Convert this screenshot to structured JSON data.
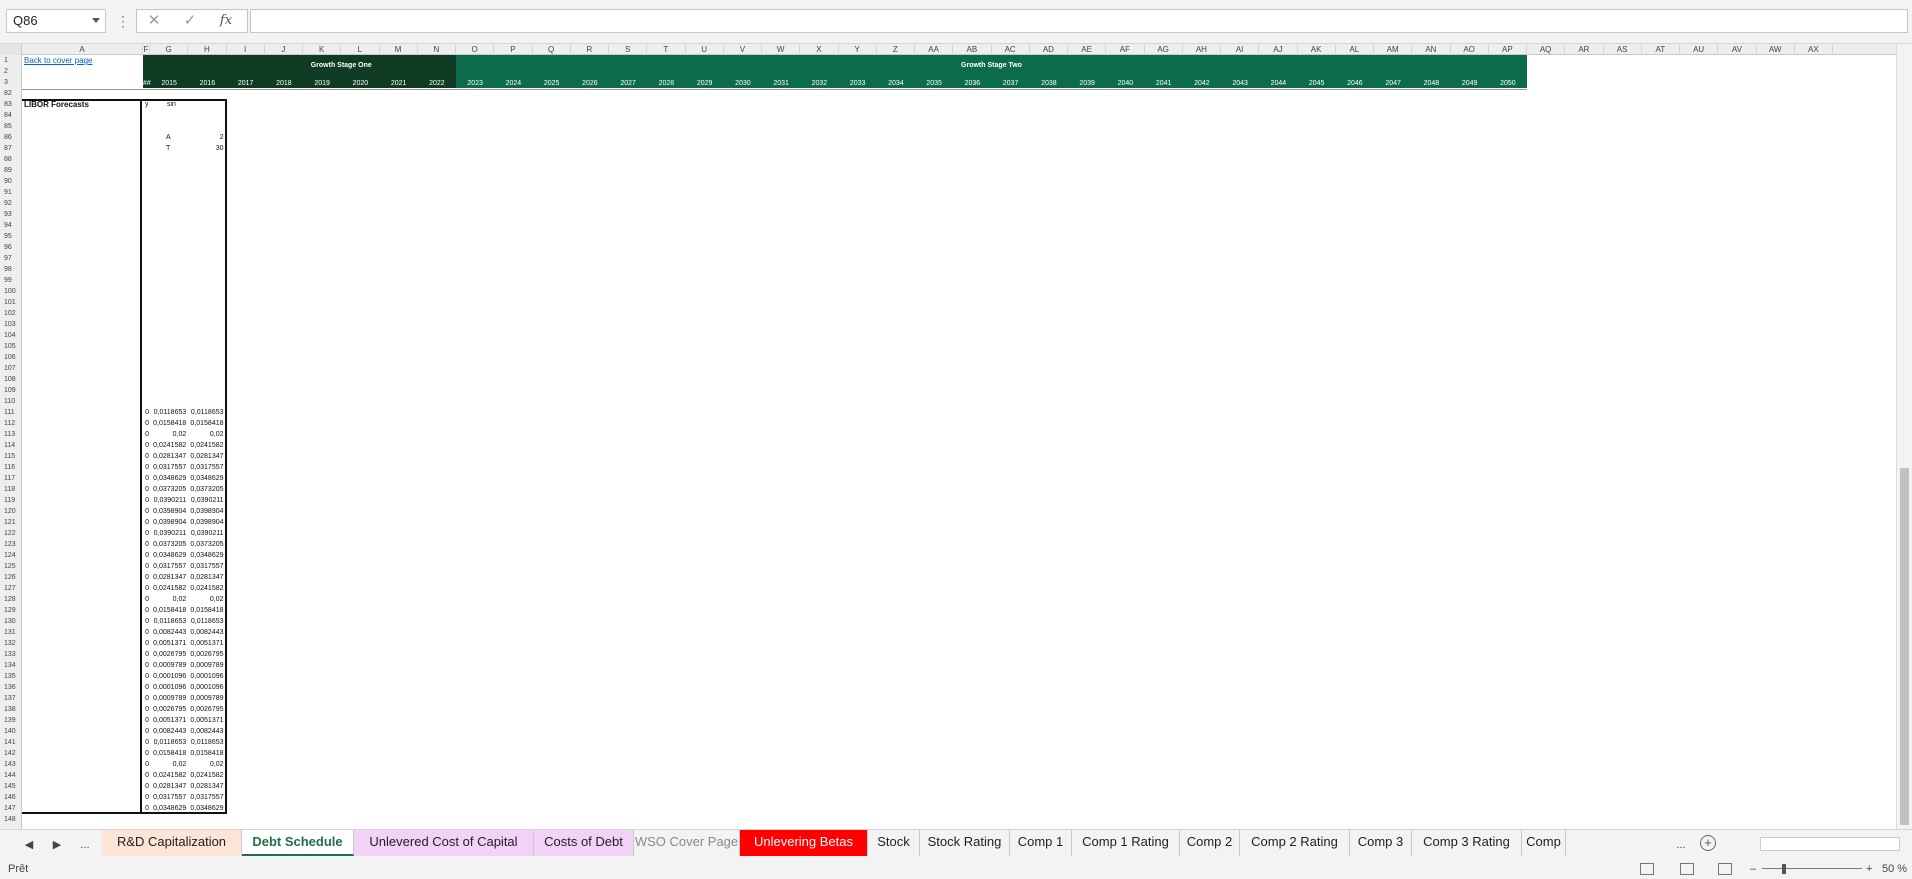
{
  "formula_bar": {
    "name_box": "Q86",
    "cancel_icon": "✕",
    "enter_icon": "✓",
    "fx_label": "fx",
    "formula": ""
  },
  "columns": [
    "A",
    "F",
    "G",
    "H",
    "I",
    "J",
    "K",
    "L",
    "M",
    "N",
    "O",
    "P",
    "Q",
    "R",
    "S",
    "T",
    "U",
    "V",
    "W",
    "X",
    "Y",
    "Z",
    "AA",
    "AB",
    "AC",
    "AD",
    "AE",
    "AF",
    "AG",
    "AH",
    "AI",
    "AJ",
    "AK",
    "AL",
    "AM",
    "AN",
    "AO",
    "AP",
    "AQ",
    "AR",
    "AS",
    "AT",
    "AU",
    "AV",
    "AW",
    "AX"
  ],
  "top_rows": [
    "1",
    "2",
    "3",
    "82"
  ],
  "link_text": "Back to cover page",
  "growth_stage_one": "Growth Stage One",
  "growth_stage_two": "Growth Stage Two",
  "hash_cell": "##",
  "years": [
    "2015",
    "2016",
    "2017",
    "2018",
    "2019",
    "2020",
    "2021",
    "2022",
    "2023",
    "2024",
    "2025",
    "2026",
    "2027",
    "2028",
    "2029",
    "2030",
    "2031",
    "2032",
    "2033",
    "2034",
    "2035",
    "2036",
    "2037",
    "2038",
    "2039",
    "2040",
    "2041",
    "2042",
    "2043",
    "2044",
    "2045",
    "2046",
    "2047",
    "2048",
    "2049",
    "2050"
  ],
  "libor_title": "LIBOR Forecasts",
  "col_labels": {
    "y": "y",
    "sin": "sin"
  },
  "params": [
    {
      "label": "A",
      "value": "2"
    },
    {
      "label": "T",
      "value": "30"
    }
  ],
  "libor_rows": [
    [
      "111",
      "0",
      "0,0118653",
      "0,0118653"
    ],
    [
      "112",
      "0",
      "0,0158418",
      "0,0158418"
    ],
    [
      "113",
      "0",
      "0,02",
      "0,02"
    ],
    [
      "114",
      "0",
      "0,0241582",
      "0,0241582"
    ],
    [
      "115",
      "0",
      "0,0281347",
      "0,0281347"
    ],
    [
      "116",
      "0",
      "0,0317557",
      "0,0317557"
    ],
    [
      "117",
      "0",
      "0,0348629",
      "0,0348629"
    ],
    [
      "118",
      "0",
      "0,0373205",
      "0,0373205"
    ],
    [
      "119",
      "0",
      "0,0390211",
      "0,0390211"
    ],
    [
      "120",
      "0",
      "0,0398904",
      "0,0398904"
    ],
    [
      "121",
      "0",
      "0,0398904",
      "0,0398904"
    ],
    [
      "122",
      "0",
      "0,0390211",
      "0,0390211"
    ],
    [
      "123",
      "0",
      "0,0373205",
      "0,0373205"
    ],
    [
      "124",
      "0",
      "0,0348629",
      "0,0348629"
    ],
    [
      "125",
      "0",
      "0,0317557",
      "0,0317557"
    ],
    [
      "126",
      "0",
      "0,0281347",
      "0,0281347"
    ],
    [
      "127",
      "0",
      "0,0241582",
      "0,0241582"
    ],
    [
      "128",
      "0",
      "0,02",
      "0,02"
    ],
    [
      "129",
      "0",
      "0,0158418",
      "0,0158418"
    ],
    [
      "130",
      "0",
      "0,0118653",
      "0,0118653"
    ],
    [
      "131",
      "0",
      "0,0082443",
      "0,0082443"
    ],
    [
      "132",
      "0",
      "0,0051371",
      "0,0051371"
    ],
    [
      "133",
      "0",
      "0,0026795",
      "0,0026795"
    ],
    [
      "134",
      "0",
      "0,0009789",
      "0,0009789"
    ],
    [
      "135",
      "0",
      "0,0001096",
      "0,0001096"
    ],
    [
      "136",
      "0",
      "0,0001096",
      "0,0001096"
    ],
    [
      "137",
      "0",
      "0,0009789",
      "0,0009789"
    ],
    [
      "138",
      "0",
      "0,0026795",
      "0,0026795"
    ],
    [
      "139",
      "0",
      "0,0051371",
      "0,0051371"
    ],
    [
      "140",
      "0",
      "0,0082443",
      "0,0082443"
    ],
    [
      "141",
      "0",
      "0,0118653",
      "0,0118653"
    ],
    [
      "142",
      "0",
      "0,0158418",
      "0,0158418"
    ],
    [
      "143",
      "0",
      "0,02",
      "0,02"
    ],
    [
      "144",
      "0",
      "0,0241582",
      "0,0241582"
    ],
    [
      "145",
      "0",
      "0,0281347",
      "0,0281347"
    ],
    [
      "146",
      "0",
      "0,0317557",
      "0,0317557"
    ],
    [
      "147",
      "0",
      "0,0348629",
      "0,0348629"
    ],
    [
      "148",
      "",
      "",
      ""
    ]
  ],
  "tab_nav": {
    "prev": "◀",
    "next": "▶",
    "more": "...",
    "more_right": "...",
    "add": "+"
  },
  "tabs": [
    {
      "label": "R&D Capitalization",
      "bg": "#fce4d6",
      "color": "#222222"
    },
    {
      "label": "Debt Schedule",
      "bg": "#ffffff",
      "color": "#1e7145",
      "active": true
    },
    {
      "label": "Unlevered Cost of Capital",
      "bg": "#f3d2f7",
      "color": "#222222"
    },
    {
      "label": "Costs of Debt",
      "bg": "#f3d2f7",
      "color": "#222222"
    },
    {
      "label": "WSO Cover Page",
      "bg": "#f3f3f3",
      "color": "#8a8a8a"
    },
    {
      "label": "Unlevering Betas",
      "bg": "#ff0000",
      "color": "#ffffff"
    },
    {
      "label": "Stock",
      "bg": "#f3f3f3",
      "color": "#222222"
    },
    {
      "label": "Stock Rating",
      "bg": "#f3f3f3",
      "color": "#222222"
    },
    {
      "label": "Comp 1",
      "bg": "#f3f3f3",
      "color": "#222222"
    },
    {
      "label": "Comp 1 Rating",
      "bg": "#f3f3f3",
      "color": "#222222"
    },
    {
      "label": "Comp 2",
      "bg": "#f3f3f3",
      "color": "#222222"
    },
    {
      "label": "Comp 2 Rating",
      "bg": "#f3f3f3",
      "color": "#222222"
    },
    {
      "label": "Comp 3",
      "bg": "#f3f3f3",
      "color": "#222222"
    },
    {
      "label": "Comp 3 Rating",
      "bg": "#f3f3f3",
      "color": "#222222"
    },
    {
      "label": "Comp",
      "bg": "#f3f3f3",
      "color": "#222222"
    }
  ],
  "status": {
    "text": "Prêt",
    "zoom": "50 %",
    "minus": "–",
    "plus": "+"
  },
  "colors": {
    "stage_one": "#0f3b24",
    "stage_two": "#0b6b4c",
    "gh_header": "#0c3a22",
    "link": "#0563c1"
  }
}
